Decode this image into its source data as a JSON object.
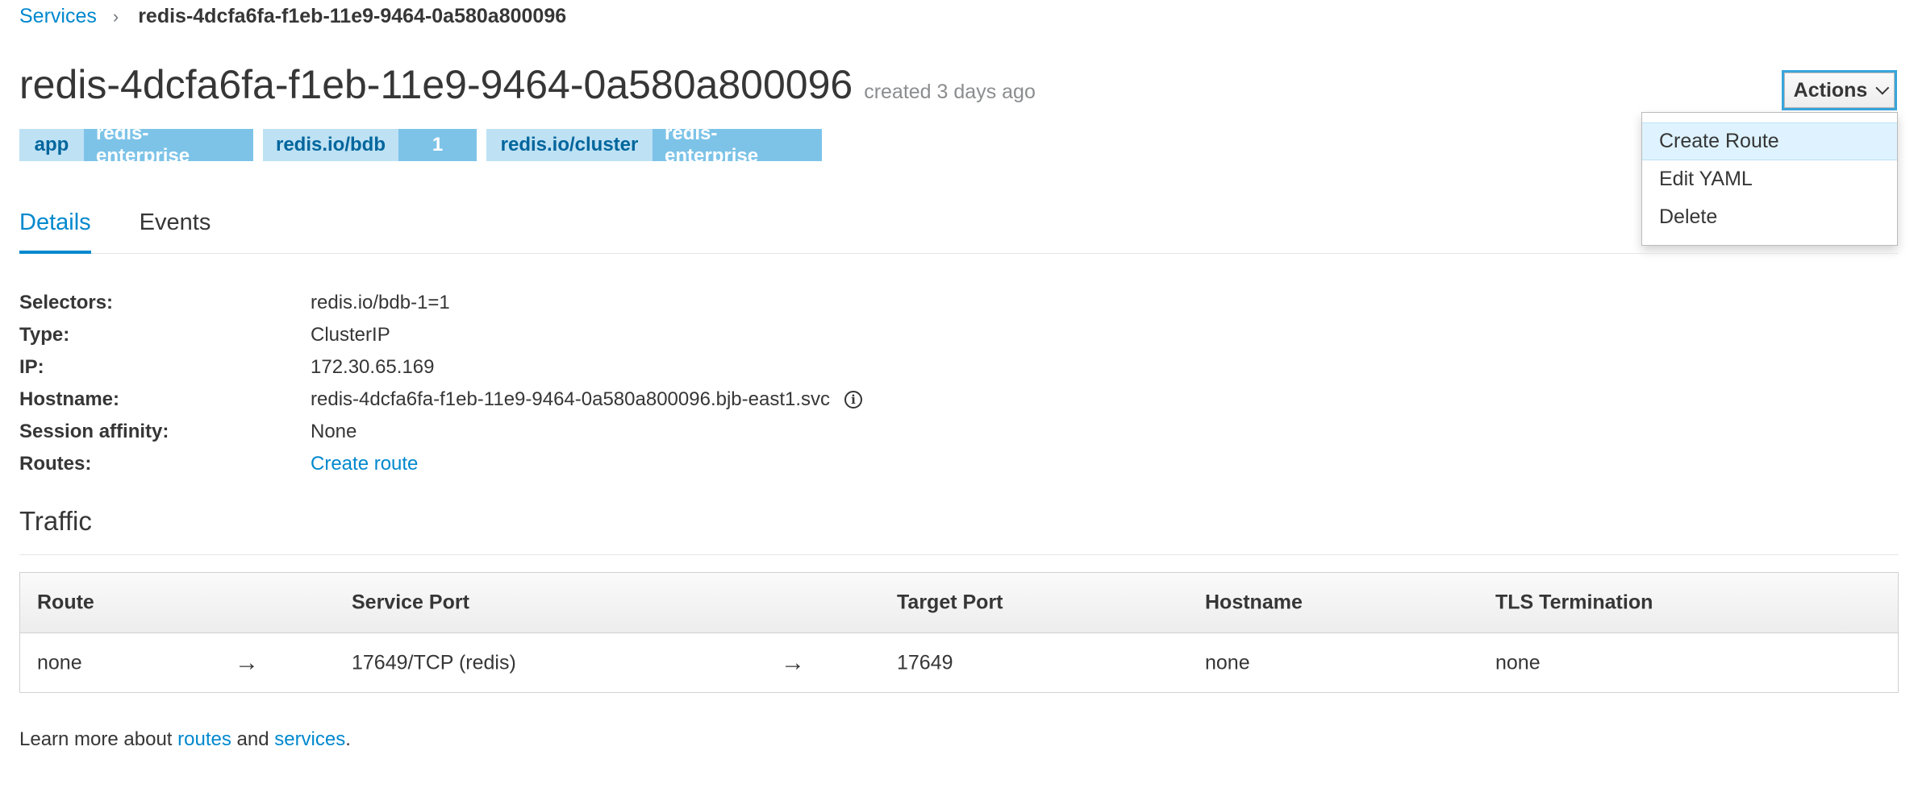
{
  "breadcrumb": {
    "parent": "Services",
    "separator": "›",
    "current": "redis-4dcfa6fa-f1eb-11e9-9464-0a580a800096"
  },
  "header": {
    "title": "redis-4dcfa6fa-f1eb-11e9-9464-0a580a800096",
    "created": "created 3 days ago"
  },
  "labels": [
    {
      "key": "app",
      "value": "redis-enterprise"
    },
    {
      "key": "redis.io/bdb",
      "value": "1"
    },
    {
      "key": "redis.io/cluster",
      "value": "redis-enterprise"
    }
  ],
  "actions": {
    "label": "Actions",
    "menu": [
      "Create Route",
      "Edit YAML",
      "Delete"
    ]
  },
  "tabs": [
    "Details",
    "Events"
  ],
  "details": {
    "selectors_label": "Selectors:",
    "selectors_value": "redis.io/bdb-1=1",
    "type_label": "Type:",
    "type_value": "ClusterIP",
    "ip_label": "IP:",
    "ip_value": "172.30.65.169",
    "hostname_label": "Hostname:",
    "hostname_value": "redis-4dcfa6fa-f1eb-11e9-9464-0a580a800096.bjb-east1.svc",
    "affinity_label": "Session affinity:",
    "affinity_value": "None",
    "routes_label": "Routes:",
    "routes_value": "Create route"
  },
  "traffic": {
    "title": "Traffic",
    "columns": [
      "Route",
      "Service Port",
      "Target Port",
      "Hostname",
      "TLS Termination"
    ],
    "row": {
      "route": "none",
      "arrow": "→",
      "service_port": "17649/TCP (redis)",
      "target_port": "17649",
      "hostname": "none",
      "tls": "none"
    }
  },
  "footer": {
    "prefix": "Learn more about ",
    "routes": "routes",
    "and": " and ",
    "services": "services",
    "suffix": "."
  },
  "colors": {
    "link": "#0088ce",
    "label_key_bg": "#bee1f4",
    "label_value_bg": "#7dc3e8",
    "active_tab": "#0088ce"
  }
}
